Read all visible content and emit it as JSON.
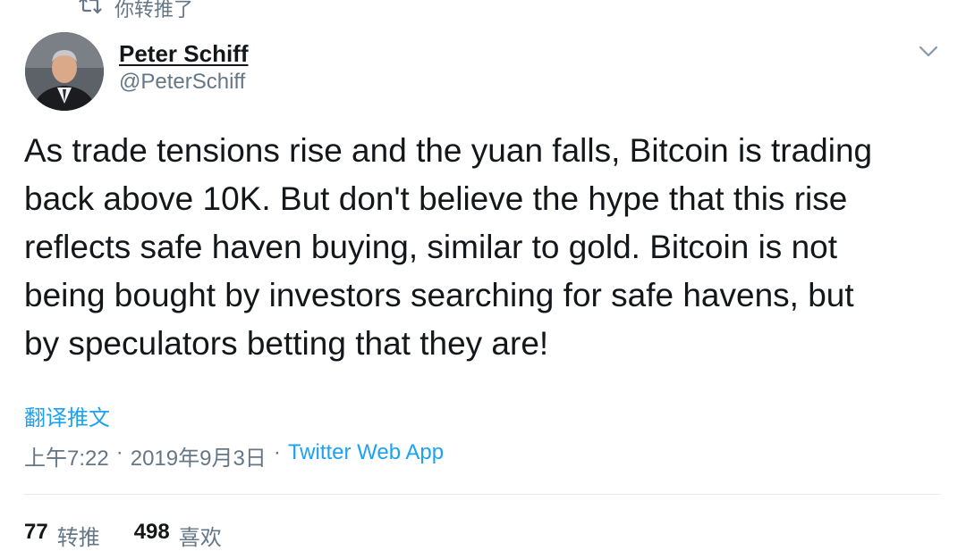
{
  "retweet_context": {
    "label": "你转推了",
    "icon": "retweet-icon"
  },
  "author": {
    "display_name": "Peter Schiff",
    "handle": "@PeterSchiff"
  },
  "tweet": {
    "text": "As trade tensions rise and the yuan falls, Bitcoin is trading\nback above 10K.   But don't believe the hype that this rise\nreflects safe haven buying, similar to gold.  Bitcoin is not\nbeing bought by investors searching for safe havens, but\nby speculators betting that they are!",
    "translate_label": "翻译推文",
    "time": "上午7:22",
    "separator": "·",
    "date": "2019年9月3日",
    "source": "Twitter Web App"
  },
  "stats": {
    "retweets": {
      "count": "77",
      "label": "转推"
    },
    "likes": {
      "count": "498",
      "label": "喜欢"
    }
  },
  "colors": {
    "link": "#1da1f2",
    "secondary_text": "#657786",
    "primary_text": "#14171a",
    "divider": "#e6ecf0"
  }
}
